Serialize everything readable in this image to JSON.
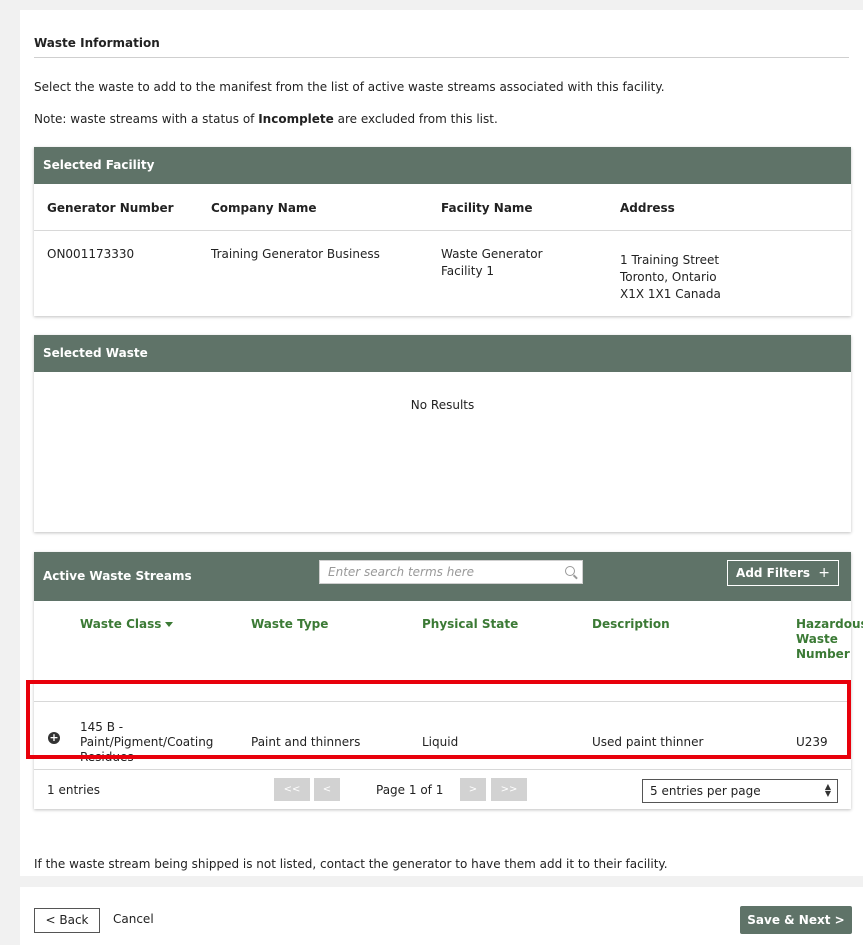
{
  "section": {
    "title": "Waste Information",
    "intro": "Select the waste to add to the manifest from the list of active waste streams associated with this facility.",
    "note_prefix": "Note: waste streams with a status of ",
    "note_bold": "Incomplete",
    "note_suffix": " are excluded from this list."
  },
  "selected_facility": {
    "title": "Selected Facility",
    "headers": [
      "Generator Number",
      "Company Name",
      "Facility Name",
      "Address"
    ],
    "row": {
      "generator_number": "ON001173330",
      "company_name": "Training Generator Business",
      "facility_name_1": "Waste Generator",
      "facility_name_2": "Facility 1",
      "address_1": "1 Training Street",
      "address_2": "Toronto, Ontario",
      "address_3": "X1X 1X1 Canada"
    }
  },
  "selected_waste": {
    "title": "Selected Waste",
    "empty_text": "No Results"
  },
  "active_streams": {
    "title": "Active Waste Streams",
    "search_placeholder": "Enter search terms here",
    "filters_label": "Add Filters",
    "filters_icon": "+",
    "headers": {
      "waste_class": "Waste Class",
      "waste_type": "Waste Type",
      "physical_state": "Physical State",
      "description": "Description",
      "haz_1": "Hazardous",
      "haz_2": "Waste",
      "haz_3": "Number"
    },
    "row": {
      "class_1": "145 B -",
      "class_2": "Paint/Pigment/Coating",
      "class_3": "Residues",
      "waste_type": "Paint and thinners",
      "physical_state": "Liquid",
      "description": "Used paint thinner",
      "haz_number": "U239"
    },
    "pager": {
      "entries": "1 entries",
      "first": "<<",
      "prev": "<",
      "page_text": "Page 1 of 1",
      "next": ">",
      "last": ">>",
      "per_page": "5 entries per page"
    }
  },
  "footer_note": "If the waste stream being shipped is not listed, contact the generator to have them add it to their facility.",
  "actions": {
    "back": "< Back",
    "cancel": "Cancel",
    "next": "Save & Next >"
  },
  "colors": {
    "panel_header": "#5f7368",
    "column_header_text": "#3b7a35",
    "highlight": "#e8000b"
  }
}
